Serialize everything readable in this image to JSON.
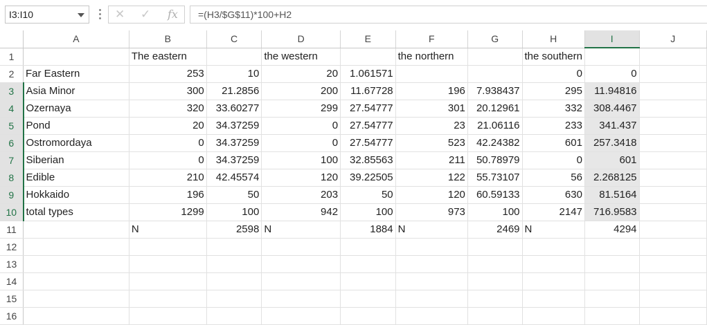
{
  "name_box": {
    "value": "I3:I10"
  },
  "formula_bar": {
    "cancel_icon": "close-icon",
    "enter_icon": "check-icon",
    "fx_label": "fx",
    "formula": "=(H3/$G$11)*100+H2"
  },
  "colors": {
    "selection_accent": "#217346",
    "selection_fill": "#e7e7e7",
    "gridline": "#e1e1e1"
  },
  "columns": [
    "A",
    "B",
    "C",
    "D",
    "E",
    "F",
    "G",
    "H",
    "I",
    "J"
  ],
  "selected_column": "I",
  "selected_rows": [
    3,
    4,
    5,
    6,
    7,
    8,
    9,
    10
  ],
  "rows": [
    {
      "num": "1",
      "cells": [
        "",
        "The eastern",
        "",
        "the western",
        "",
        "the northern",
        "",
        "the southern",
        "",
        ""
      ]
    },
    {
      "num": "2",
      "cells": [
        "Far Eastern",
        "253",
        "10",
        "20",
        "1.061571",
        "",
        "",
        "0",
        "0",
        ""
      ]
    },
    {
      "num": "3",
      "cells": [
        "Asia Minor",
        "300",
        "21.2856",
        "200",
        "11.67728",
        "196",
        "7.938437",
        "295",
        "11.94816",
        ""
      ]
    },
    {
      "num": "4",
      "cells": [
        "Ozernaya",
        "320",
        "33.60277",
        "299",
        "27.54777",
        "301",
        "20.12961",
        "332",
        "308.4467",
        ""
      ]
    },
    {
      "num": "5",
      "cells": [
        "Pond",
        "20",
        "34.37259",
        "0",
        "27.54777",
        "23",
        "21.06116",
        "233",
        "341.437",
        ""
      ]
    },
    {
      "num": "6",
      "cells": [
        "Ostromordaya",
        "0",
        "34.37259",
        "0",
        "27.54777",
        "523",
        "42.24382",
        "601",
        "257.3418",
        ""
      ]
    },
    {
      "num": "7",
      "cells": [
        "Siberian",
        "0",
        "34.37259",
        "100",
        "32.85563",
        "211",
        "50.78979",
        "0",
        "601",
        ""
      ]
    },
    {
      "num": "8",
      "cells": [
        "Edible",
        "210",
        "42.45574",
        "120",
        "39.22505",
        "122",
        "55.73107",
        "56",
        "2.268125",
        ""
      ]
    },
    {
      "num": "9",
      "cells": [
        "Hokkaido",
        "196",
        "50",
        "203",
        "50",
        "120",
        "60.59133",
        "630",
        "81.5164",
        ""
      ]
    },
    {
      "num": "10",
      "cells": [
        "total types",
        "1299",
        "100",
        "942",
        "100",
        "973",
        "100",
        "2147",
        "716.9583",
        ""
      ]
    },
    {
      "num": "11",
      "cells": [
        "",
        "N",
        "2598",
        "N",
        "1884",
        "N",
        "2469",
        "N",
        "4294",
        ""
      ]
    },
    {
      "num": "12",
      "cells": [
        "",
        "",
        "",
        "",
        "",
        "",
        "",
        "",
        "",
        ""
      ]
    },
    {
      "num": "13",
      "cells": [
        "",
        "",
        "",
        "",
        "",
        "",
        "",
        "",
        "",
        ""
      ]
    },
    {
      "num": "14",
      "cells": [
        "",
        "",
        "",
        "",
        "",
        "",
        "",
        "",
        "",
        ""
      ]
    },
    {
      "num": "15",
      "cells": [
        "",
        "",
        "",
        "",
        "",
        "",
        "",
        "",
        "",
        ""
      ]
    },
    {
      "num": "16",
      "cells": [
        "",
        "",
        "",
        "",
        "",
        "",
        "",
        "",
        "",
        ""
      ]
    }
  ]
}
